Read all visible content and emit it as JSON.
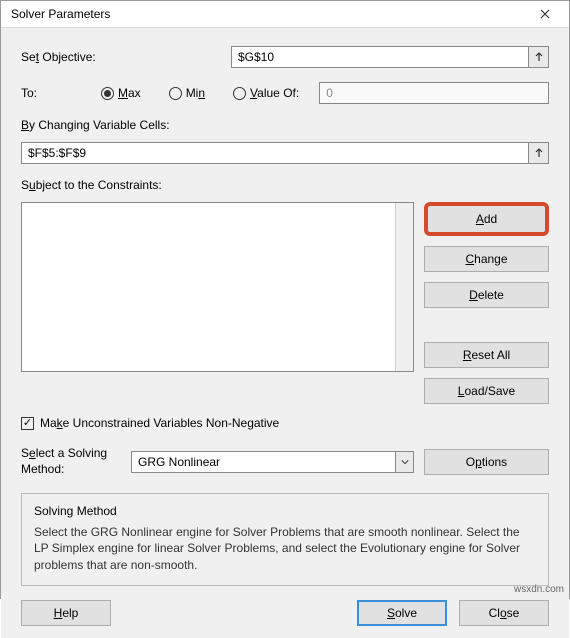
{
  "window": {
    "title": "Solver Parameters"
  },
  "labels": {
    "set_objective_pre": "Se",
    "set_objective_u": "t",
    "set_objective_post": " Objective:",
    "to": "To:",
    "max_u": "M",
    "max_post": "ax",
    "min_pre": "Mi",
    "min_u": "n",
    "valueof_u": "V",
    "valueof_post": "alue Of:",
    "by_u": "B",
    "by_post": "y Changing Variable Cells:",
    "subject_pre": "S",
    "subject_u": "u",
    "subject_post": "bject to the Constraints:",
    "make_pre": "Ma",
    "make_u": "k",
    "make_post": "e Unconstrained Variables Non-Negative",
    "select_method_pre": "S",
    "select_method_u": "e",
    "select_method_post": "lect a Solving Method:",
    "solving_method_title": "Solving Method",
    "solving_method_text": "Select the GRG Nonlinear engine for Solver Problems that are smooth nonlinear. Select the LP Simplex engine for linear Solver Problems, and select the Evolutionary engine for Solver problems that are non-smooth."
  },
  "inputs": {
    "objective": "$G$10",
    "value_of": "0",
    "changing_cells": "$F$5:$F$9",
    "method_selected": "GRG Nonlinear"
  },
  "buttons": {
    "add_u": "A",
    "add_post": "dd",
    "change_u": "C",
    "change_post": "hange",
    "delete_u": "D",
    "delete_post": "elete",
    "reset_u": "R",
    "reset_post": "eset All",
    "load_u": "L",
    "load_post": "oad/Save",
    "options_pre": "O",
    "options_u": "p",
    "options_post": "tions",
    "help_u": "H",
    "help_post": "elp",
    "solve_u": "S",
    "solve_post": "olve",
    "close_pre": "Cl",
    "close_u": "o",
    "close_post": "se"
  },
  "watermark": "wsxdn.com"
}
